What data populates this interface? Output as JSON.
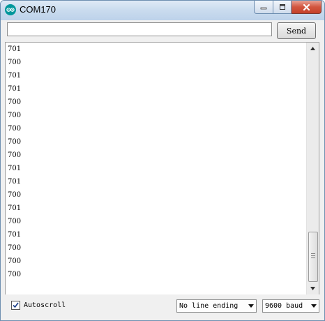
{
  "window": {
    "title": "COM170",
    "icon": "arduino-logo-icon",
    "colors": {
      "app_icon": "#00979c",
      "close_button": "#c5412a"
    }
  },
  "toolbar": {
    "input_value": "",
    "input_placeholder": "",
    "send_label": "Send"
  },
  "output": {
    "lines": [
      "701",
      "700",
      "701",
      "701",
      "700",
      "700",
      "700",
      "700",
      "700",
      "701",
      "701",
      "700",
      "701",
      "700",
      "701",
      "700",
      "700",
      "700"
    ]
  },
  "statusbar": {
    "autoscroll_label": "Autoscroll",
    "autoscroll_checked": true,
    "line_ending": "No line ending",
    "baud_rate": "9600 baud"
  }
}
